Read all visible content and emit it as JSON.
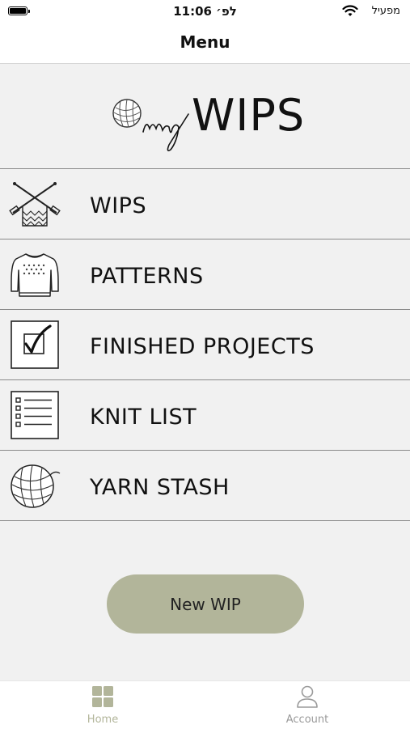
{
  "status_bar": {
    "time": "11:06 לפ׳",
    "carrier": "מפעיל"
  },
  "nav": {
    "title": "Menu"
  },
  "logo": {
    "text": "WIPS",
    "script_text": "my"
  },
  "menu": {
    "items": [
      {
        "label": "WIPS",
        "icon": "knitting-needles-icon"
      },
      {
        "label": "PATTERNS",
        "icon": "sweater-icon"
      },
      {
        "label": "FINISHED PROJECTS",
        "icon": "checkbox-icon"
      },
      {
        "label": "KNIT LIST",
        "icon": "list-icon"
      },
      {
        "label": "YARN STASH",
        "icon": "yarn-ball-icon"
      }
    ]
  },
  "actions": {
    "new_wip_label": "New WIP"
  },
  "tabs": [
    {
      "label": "Home",
      "icon": "grid-icon",
      "active": true
    },
    {
      "label": "Account",
      "icon": "person-icon",
      "active": false
    }
  ],
  "colors": {
    "accent": "#b2b59a",
    "background": "#f1f1f1",
    "divider": "#8a8a8a"
  }
}
